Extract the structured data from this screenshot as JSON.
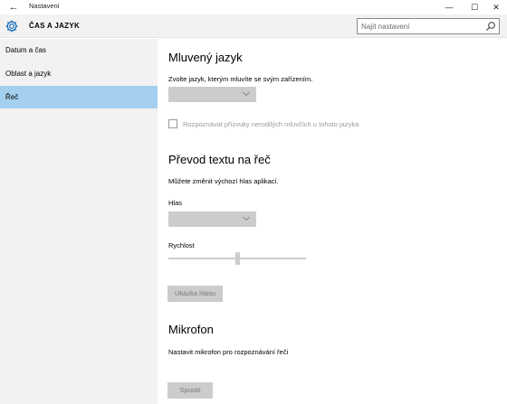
{
  "window": {
    "title": "Nastavení",
    "back_icon": "←",
    "minimize_icon": "—",
    "maximize_icon": "☐",
    "close_icon": "✕"
  },
  "header": {
    "title": "ČAS A JAZYK",
    "icon": "gear-icon",
    "search_placeholder": "Najít nastavení"
  },
  "sidebar": {
    "items": [
      {
        "label": "Datum a čas",
        "selected": false
      },
      {
        "label": "Oblast a jazyk",
        "selected": false
      },
      {
        "label": "Řeč",
        "selected": true
      }
    ]
  },
  "main": {
    "spoken_language": {
      "heading": "Mluvený jazyk",
      "description": "Zvolte jazyk, kterým mluvíte se svým zařízením.",
      "selected_value": "",
      "checkbox_label": "Rozpoznávat přízvuky nerodilých mluvčích u tohoto jazyka",
      "checkbox_checked": false
    },
    "tts": {
      "heading": "Převod textu na řeč",
      "description": "Můžete změnit výchozí hlas aplikací.",
      "voice_label": "Hlas",
      "voice_value": "",
      "speed_label": "Rychlost",
      "speed_level": 0.5,
      "sample_button": "Ukázka hlasu"
    },
    "microphone": {
      "heading": "Mikrofon",
      "description": "Nastavit mikrofon pro rozpoznávání řeči",
      "start_button": "Spustit"
    }
  },
  "colors": {
    "accent_selected": "#a4cfef",
    "sidebar_bg": "#f2f2f2",
    "disabled_control": "#cccccc"
  }
}
